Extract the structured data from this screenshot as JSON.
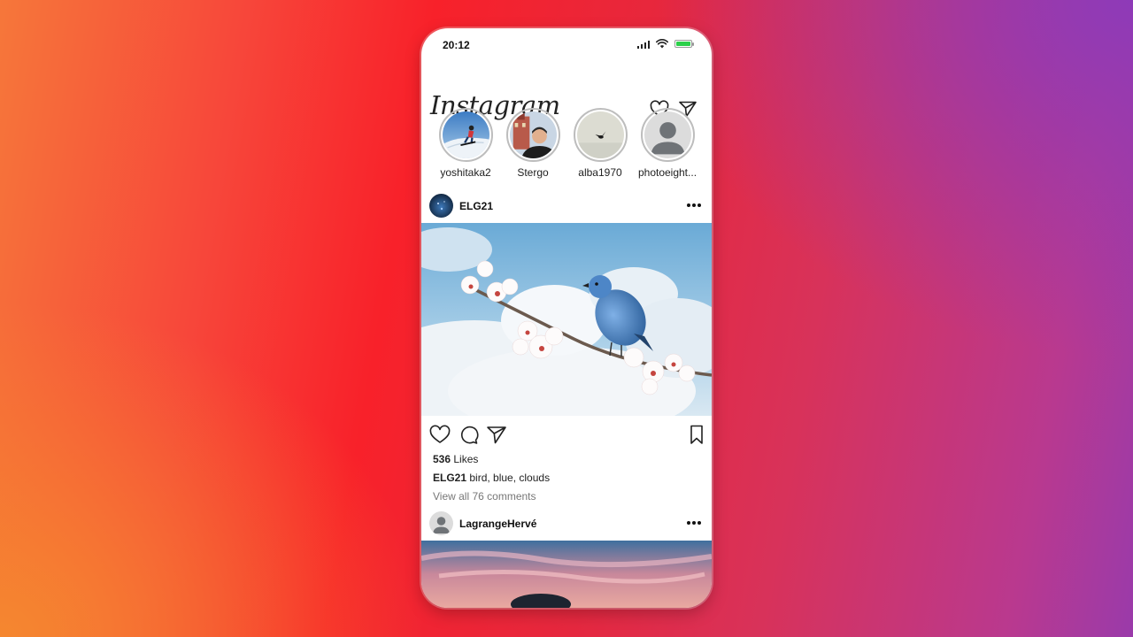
{
  "status_bar": {
    "time": "20:12"
  },
  "header": {
    "logo": "Instagram"
  },
  "stories": [
    {
      "username": "yoshitaka2"
    },
    {
      "username": "Stergo"
    },
    {
      "username": "alba1970"
    },
    {
      "username": "photoeight..."
    }
  ],
  "posts": [
    {
      "username": "ELG21",
      "likes_count": "536",
      "likes_label": "Likes",
      "caption_user": "ELG21",
      "caption_text": "bird, blue, clouds",
      "comments_link": "View all 76 comments"
    },
    {
      "username": "LagrangeHervé"
    }
  ],
  "colors": {
    "battery": "#2bd04a",
    "story_ring": "#bdbdbd",
    "muted_text": "#777777"
  }
}
